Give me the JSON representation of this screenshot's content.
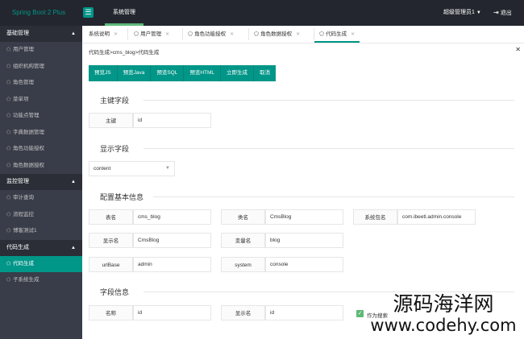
{
  "topbar": {
    "brand": "Spring Boot 2 Plus",
    "menu_icon": "menu-icon",
    "nav_item": "系统管理",
    "user": "超级管理员1",
    "logout": "退出"
  },
  "sidebar": {
    "groups": [
      {
        "title": "基础管理",
        "items": [
          "用户管理",
          "组织机构管理",
          "角色管理",
          "菜单项",
          "功能点管理",
          "字典数据管理",
          "角色功能授权",
          "角色数据授权"
        ]
      },
      {
        "title": "监控管理",
        "items": [
          "审计查询",
          "流程监控",
          "博客测试1"
        ]
      },
      {
        "title": "代码生成",
        "items": [
          "代码生成",
          "子系统生成"
        ]
      }
    ]
  },
  "tabs": [
    {
      "label": "系统说明",
      "has_icon": false
    },
    {
      "label": "用户管理",
      "has_icon": true
    },
    {
      "label": "角色功能授权",
      "has_icon": true
    },
    {
      "label": "角色数据授权",
      "has_icon": true
    },
    {
      "label": "代码生成",
      "has_icon": true,
      "active": true
    }
  ],
  "breadcrumb": "代码生成>cms_blog>代码生成",
  "toolbar": {
    "buttons": [
      "预览JS",
      "预览Java",
      "预览SQL",
      "预览HTML",
      "立即生成",
      "取消"
    ]
  },
  "sections": {
    "primary_key": {
      "title": "主键字段",
      "label": "主键",
      "value": "id"
    },
    "display": {
      "title": "显示字段",
      "selected": "content"
    },
    "basic": {
      "title": "配置基本信息",
      "fields": [
        {
          "label": "表名",
          "value": "cms_blog"
        },
        {
          "label": "类名",
          "value": "CmsBlog"
        },
        {
          "label": "系统包名",
          "value": "com.ibeetl.admin.console"
        },
        {
          "label": "显示名",
          "value": "CmsBlog"
        },
        {
          "label": "变量名",
          "value": "blog"
        },
        {
          "label": "urlBase",
          "value": "admin"
        },
        {
          "label": "system",
          "value": "console"
        }
      ]
    },
    "fields": {
      "title": "字段信息",
      "name_label": "名称",
      "name_value": "id",
      "display_label": "显示名",
      "display_value": "id",
      "checkbox_label": "作为搜索"
    }
  },
  "watermark": {
    "cn": "源码海洋网",
    "url": "www.codehy.com"
  },
  "colors": {
    "accent": "#009688",
    "sidebar_bg": "#393d49",
    "topbar_bg": "#23262e",
    "checkbox": "#5fb878"
  }
}
